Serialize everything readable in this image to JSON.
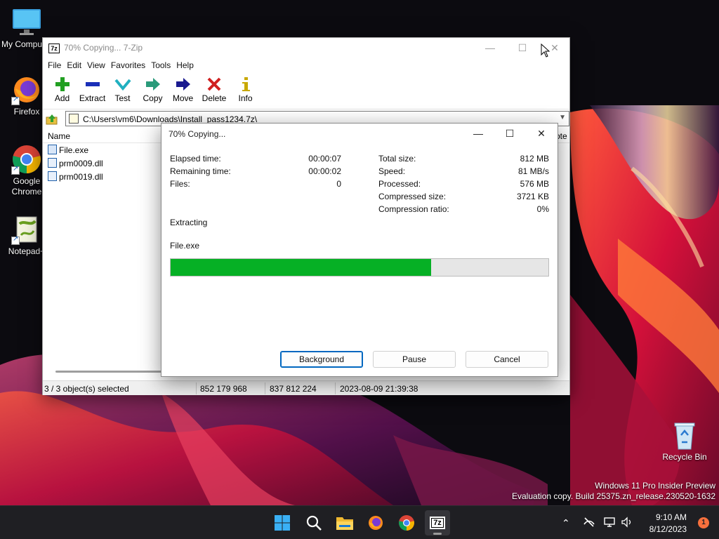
{
  "desktop": {
    "icons": [
      {
        "label": "My Compu",
        "icon": "monitor-icon"
      },
      {
        "label": "Firefox",
        "icon": "firefox-icon"
      },
      {
        "label": "Google Chrome",
        "icon": "chrome-icon"
      },
      {
        "label": "Notepad+",
        "icon": "notepad-plus-plus-icon"
      },
      {
        "label": "Recycle Bin",
        "icon": "recycle-bin-icon"
      }
    ],
    "watermark": {
      "line1": "Windows 11 Pro Insider Preview",
      "line2": "Evaluation copy. Build 25375.zn_release.230520-1632"
    }
  },
  "zip_window": {
    "app_icon_text": "7z",
    "title": "70% Copying... 7-Zip",
    "controls": {
      "minimize": "—",
      "maximize": "☐",
      "close": "✕"
    },
    "menu": [
      "File",
      "Edit",
      "View",
      "Favorites",
      "Tools",
      "Help"
    ],
    "toolbar": [
      {
        "label": "Add",
        "icon": "add-icon",
        "color": "#22a022"
      },
      {
        "label": "Extract",
        "icon": "extract-icon",
        "color": "#1a2fb8"
      },
      {
        "label": "Test",
        "icon": "test-icon",
        "color": "#20b0c0"
      },
      {
        "label": "Copy",
        "icon": "copy-icon",
        "color": "#2a9a7a"
      },
      {
        "label": "Move",
        "icon": "move-icon",
        "color": "#1a1a90"
      },
      {
        "label": "Delete",
        "icon": "delete-icon",
        "color": "#d02020"
      },
      {
        "label": "Info",
        "icon": "info-icon",
        "color": "#c8a800"
      }
    ],
    "address": "C:\\Users\\vm6\\Downloads\\Install_pass1234.7z\\",
    "columns": {
      "name": "Name",
      "partial_right": "ote"
    },
    "files": [
      {
        "name": "File.exe"
      },
      {
        "name": "prm0009.dll"
      },
      {
        "name": "prm0019.dll"
      }
    ],
    "status": {
      "selected": "3 / 3 object(s) selected",
      "size": "852 179 968",
      "packed": "837 812 224",
      "modified": "2023-08-09 21:39:38"
    }
  },
  "dialog": {
    "title": "70% Copying...",
    "left_stats": [
      {
        "label": "Elapsed time:",
        "value": "00:00:07"
      },
      {
        "label": "Remaining time:",
        "value": "00:00:02"
      },
      {
        "label": "Files:",
        "value": "0"
      }
    ],
    "right_stats": [
      {
        "label": "Total size:",
        "value": "812 MB"
      },
      {
        "label": "Speed:",
        "value": "81 MB/s"
      },
      {
        "label": "Processed:",
        "value": "576 MB"
      },
      {
        "label": "Compressed size:",
        "value": "3721 KB"
      },
      {
        "label": "Compression ratio:",
        "value": "0%"
      }
    ],
    "operation": "Extracting",
    "current_file": "File.exe",
    "progress_fraction": 0.69,
    "progress_color": "#06b025",
    "buttons": {
      "background": "Background",
      "pause": "Pause",
      "cancel": "Cancel"
    }
  },
  "taskbar": {
    "apps": [
      {
        "icon": "windows-start-icon"
      },
      {
        "icon": "search-icon"
      },
      {
        "icon": "file-explorer-icon"
      },
      {
        "icon": "firefox-icon"
      },
      {
        "icon": "chrome-icon"
      },
      {
        "icon": "7zip-icon",
        "text": "7z",
        "active": true
      }
    ],
    "clock": {
      "time": "9:10 AM",
      "date": "8/12/2023"
    },
    "notification_count": "1"
  }
}
